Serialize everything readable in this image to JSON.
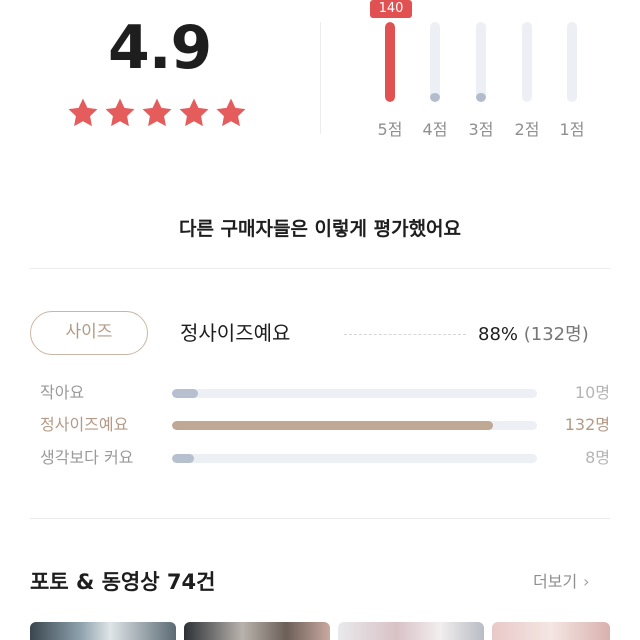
{
  "rating": {
    "average": "4.9",
    "stars": 5,
    "star_color": "#e45c5c",
    "top_count": "140",
    "histogram": [
      {
        "label": "5점",
        "fraction": 1.0,
        "color": "#e15151"
      },
      {
        "label": "4점",
        "fraction": 0.06,
        "color": "#b3bccc"
      },
      {
        "label": "3점",
        "fraction": 0.06,
        "color": "#b3bccc"
      },
      {
        "label": "2점",
        "fraction": 0.0,
        "color": "#b3bccc"
      },
      {
        "label": "1점",
        "fraction": 0.0,
        "color": "#b3bccc"
      }
    ]
  },
  "headline": "다른 구매자들은 이렇게 평가했어요",
  "size": {
    "pill_label": "사이즈",
    "top_answer": "정사이즈예요",
    "top_percent": "88%",
    "top_count": "(132명)",
    "rows": [
      {
        "label": "작아요",
        "count": "10명",
        "fraction": 0.07,
        "highlight": false
      },
      {
        "label": "정사이즈예요",
        "count": "132명",
        "fraction": 0.88,
        "highlight": true
      },
      {
        "label": "생각보다 커요",
        "count": "8명",
        "fraction": 0.06,
        "highlight": false
      }
    ]
  },
  "photos": {
    "title": "포토 & 동영상 74건",
    "more_label": "더보기",
    "more_icon": "chevron-right-icon"
  }
}
